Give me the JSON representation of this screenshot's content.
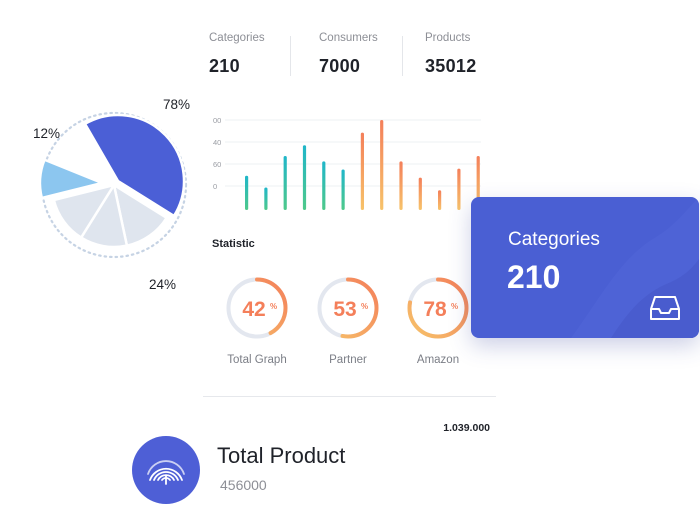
{
  "stats": [
    {
      "label": "Categories",
      "value": "210"
    },
    {
      "label": "Consumers",
      "value": "7000"
    },
    {
      "label": "Products",
      "value": "35012"
    }
  ],
  "bar_chart": {
    "y_ticks": [
      "00",
      "40",
      "60",
      "0"
    ],
    "values": [
      38,
      25,
      60,
      72,
      54,
      45,
      86,
      100,
      54,
      36,
      22,
      46,
      60
    ],
    "colors": [
      [
        "#4fc98a",
        "#1fb6c9"
      ],
      [
        "#4fc98a",
        "#1fb6c9"
      ],
      [
        "#4fc98a",
        "#1fb6c9"
      ],
      [
        "#4fc98a",
        "#1fb6c9"
      ],
      [
        "#4fc98a",
        "#1fb6c9"
      ],
      [
        "#4fc98a",
        "#1fb6c9"
      ],
      [
        "#f7c36a",
        "#f47f5a"
      ],
      [
        "#f7c36a",
        "#f47f5a"
      ],
      [
        "#f7c36a",
        "#f47f5a"
      ],
      [
        "#f7c36a",
        "#f47f5a"
      ],
      [
        "#f7c36a",
        "#f47f5a"
      ],
      [
        "#f7c36a",
        "#f47f5a"
      ],
      [
        "#f7c36a",
        "#f47f5a"
      ]
    ]
  },
  "statistic": {
    "title": "Statistic",
    "rings": [
      {
        "value": "42",
        "unit": "%",
        "label": "Total Graph",
        "fraction": 0.42
      },
      {
        "value": "53",
        "unit": "%",
        "label": "Partner",
        "fraction": 0.53
      },
      {
        "value": "78",
        "unit": "%",
        "label": "Amazon",
        "fraction": 0.78
      }
    ]
  },
  "pie_chart": {
    "labels": {
      "big": "78%",
      "small": "12%",
      "mid": "24%"
    },
    "colors": {
      "big": "#4b5fd6",
      "small": "#8cc6ef",
      "rest": "#dfe5ee",
      "dots": "#c6d3e4"
    }
  },
  "amount": "1.039.000",
  "product": {
    "title": "Total Product",
    "value": "456000",
    "icon": "fingerprint-icon"
  },
  "card": {
    "label": "Categories",
    "value": "210",
    "icon": "inbox-icon",
    "color": "#4a5fd3"
  },
  "accent": {
    "blue": "#4b5fd6",
    "orange": "#f47f5a",
    "ring_track": "#e3e7ef"
  }
}
